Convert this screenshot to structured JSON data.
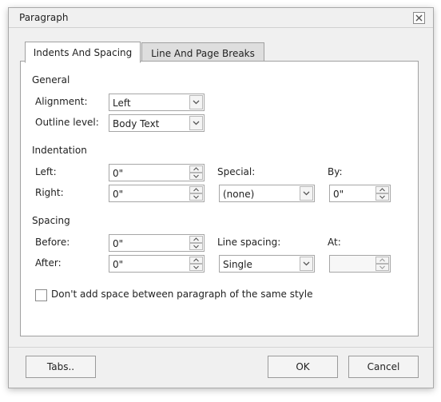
{
  "dialog": {
    "title": "Paragraph",
    "close_icon": "close-icon"
  },
  "tabs": [
    {
      "label": "Indents And Spacing",
      "active": true
    },
    {
      "label": "Line And Page Breaks",
      "active": false
    }
  ],
  "general": {
    "title": "General",
    "alignment_label": "Alignment:",
    "alignment_value": "Left",
    "outline_label": "Outline level:",
    "outline_value": "Body Text"
  },
  "indentation": {
    "title": "Indentation",
    "left_label": "Left:",
    "left_value": "0\"",
    "right_label": "Right:",
    "right_value": "0\"",
    "special_label": "Special:",
    "special_value": "(none)",
    "by_label": "By:",
    "by_value": "0\""
  },
  "spacing": {
    "title": "Spacing",
    "before_label": "Before:",
    "before_value": "0\"",
    "after_label": "After:",
    "after_value": "0\"",
    "line_spacing_label": "Line spacing:",
    "line_spacing_value": "Single",
    "at_label": "At:",
    "at_value": ""
  },
  "checkbox": {
    "label": "Don't add space between paragraph of the same style",
    "checked": false
  },
  "buttons": {
    "tabs": "Tabs..",
    "ok": "OK",
    "cancel": "Cancel"
  },
  "colors": {
    "dialog_bg": "#f0f0f0",
    "panel_bg": "#ffffff",
    "border": "#a0a0a0"
  }
}
